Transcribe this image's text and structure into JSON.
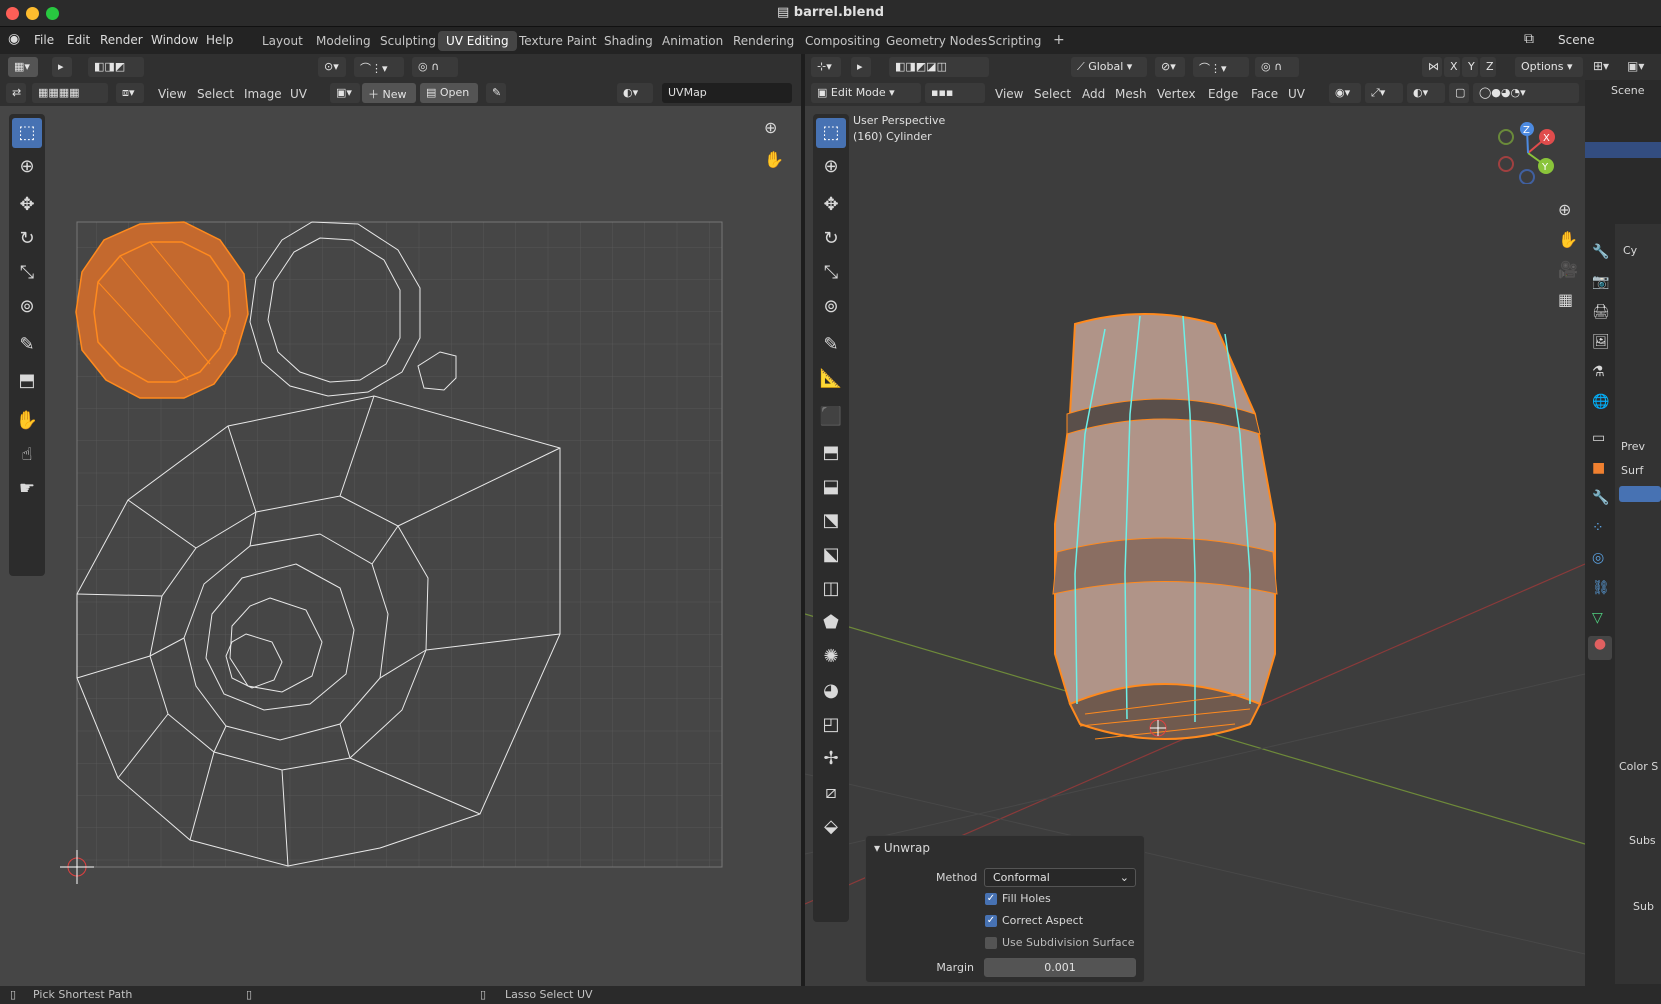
{
  "window": {
    "title": "barrel.blend"
  },
  "menus": [
    "File",
    "Edit",
    "Render",
    "Window",
    "Help"
  ],
  "workspaces": [
    "Layout",
    "Modeling",
    "Sculpting",
    "UV Editing",
    "Texture Paint",
    "Shading",
    "Animation",
    "Rendering",
    "Compositing",
    "Geometry Nodes",
    "Scripting"
  ],
  "active_workspace": "UV Editing",
  "scene": "Scene",
  "uv_editor": {
    "menus": [
      "View",
      "Select",
      "Image",
      "UV"
    ],
    "new_label": "New",
    "open_label": "Open",
    "uvmap": "UVMap"
  },
  "viewport": {
    "transform": "Global",
    "mode": "Edit Mode",
    "menus": [
      "View",
      "Select",
      "Add",
      "Mesh",
      "Vertex",
      "Edge",
      "Face",
      "UV"
    ],
    "axes": [
      "X",
      "Y",
      "Z"
    ],
    "options": "Options",
    "perspective": "User Perspective",
    "object": "(160) Cylinder",
    "gizmo": {
      "x": "X",
      "y": "Y",
      "z": "Z"
    }
  },
  "unwrap_panel": {
    "title": "Unwrap",
    "method_label": "Method",
    "method_value": "Conformal",
    "fill_holes": "Fill Holes",
    "correct_aspect": "Correct Aspect",
    "use_subsurf": "Use Subdivision Surface",
    "margin_label": "Margin",
    "margin_value": "0.001"
  },
  "properties": {
    "items": [
      "Scene",
      "Cy",
      "Prev",
      "Surf",
      "Color S",
      "Subs",
      "Sub"
    ]
  },
  "status": {
    "left": "Pick Shortest Path",
    "middle": "Lasso Select UV"
  },
  "colors": {
    "accent": "#4772b3",
    "selection": "#ff8a1e",
    "seam": "#6cf0e8"
  }
}
